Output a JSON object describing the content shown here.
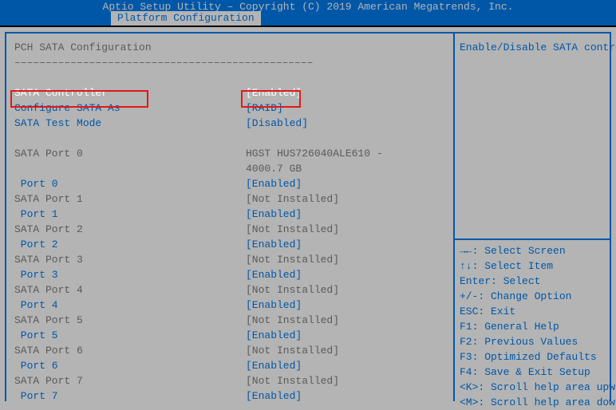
{
  "header": {
    "title": "Aptio Setup Utility – Copyright (C) 2019 American Megatrends, Inc.",
    "tab": "Platform Configuration"
  },
  "section": {
    "title": "PCH SATA Configuration",
    "dashes": "––––––––––––––––––––––––––––––––––––––––––––––––",
    "help_text": "Enable/Disable SATA controller"
  },
  "selected": {
    "label": "SATA Controller",
    "value": "[Enabled]"
  },
  "menu": [
    {
      "label": "Configure SATA As",
      "value": "[RAID]",
      "cls": "blue"
    },
    {
      "label": "SATA Test Mode",
      "value": "[Disabled]",
      "cls": "blue"
    }
  ],
  "ports": [
    {
      "plabel": "SATA Port 0",
      "pval": "HGST HUS726040ALE610 -",
      "pval2": "4000.7 GB",
      "sub": "Port 0",
      "subval": "[Enabled]"
    },
    {
      "plabel": "SATA Port 1",
      "pval": "[Not Installed]",
      "sub": "Port 1",
      "subval": "[Enabled]"
    },
    {
      "plabel": "SATA Port 2",
      "pval": "[Not Installed]",
      "sub": "Port 2",
      "subval": "[Enabled]"
    },
    {
      "plabel": "SATA Port 3",
      "pval": "[Not Installed]",
      "sub": "Port 3",
      "subval": "[Enabled]"
    },
    {
      "plabel": "SATA Port 4",
      "pval": "[Not Installed]",
      "sub": "Port 4",
      "subval": "[Enabled]"
    },
    {
      "plabel": "SATA Port 5",
      "pval": "[Not Installed]",
      "sub": "Port 5",
      "subval": "[Enabled]"
    },
    {
      "plabel": "SATA Port 6",
      "pval": "[Not Installed]",
      "sub": "Port 6",
      "subval": "[Enabled]"
    },
    {
      "plabel": "SATA Port 7",
      "pval": "[Not Installed]",
      "sub": "Port 7",
      "subval": "[Enabled]"
    }
  ],
  "help": [
    "→←: Select Screen",
    "↑↓: Select Item",
    "Enter: Select",
    "+/-: Change Option",
    "ESC: Exit",
    "F1: General Help",
    "F2: Previous Values",
    "F3: Optimized Defaults",
    "F4: Save & Exit Setup",
    "<K>: Scroll help area upwards",
    "<M>: Scroll help area downwards"
  ]
}
